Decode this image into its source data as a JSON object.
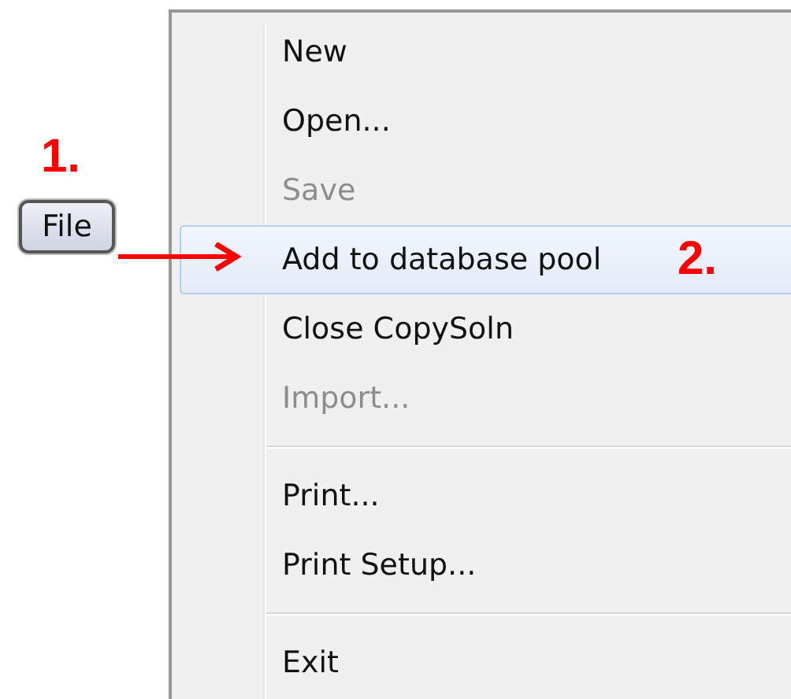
{
  "file_button": {
    "label": "File"
  },
  "annotations": [
    {
      "text": "1."
    },
    {
      "text": "2."
    }
  ],
  "menu": {
    "items": [
      {
        "kind": "item",
        "label": "New",
        "disabled": false,
        "selected": false
      },
      {
        "kind": "item",
        "label": "Open...",
        "disabled": false,
        "selected": false
      },
      {
        "kind": "item",
        "label": "Save",
        "disabled": true,
        "selected": false
      },
      {
        "kind": "item",
        "label": "Add to database pool",
        "disabled": false,
        "selected": true
      },
      {
        "kind": "item",
        "label": "Close CopySoln",
        "disabled": false,
        "selected": false
      },
      {
        "kind": "item",
        "label": "Import...",
        "disabled": true,
        "selected": false
      },
      {
        "kind": "separator"
      },
      {
        "kind": "item",
        "label": "Print...",
        "disabled": false,
        "selected": false
      },
      {
        "kind": "item",
        "label": "Print Setup...",
        "disabled": false,
        "selected": false
      },
      {
        "kind": "separator"
      },
      {
        "kind": "item",
        "label": "Exit",
        "disabled": false,
        "selected": false
      }
    ]
  }
}
